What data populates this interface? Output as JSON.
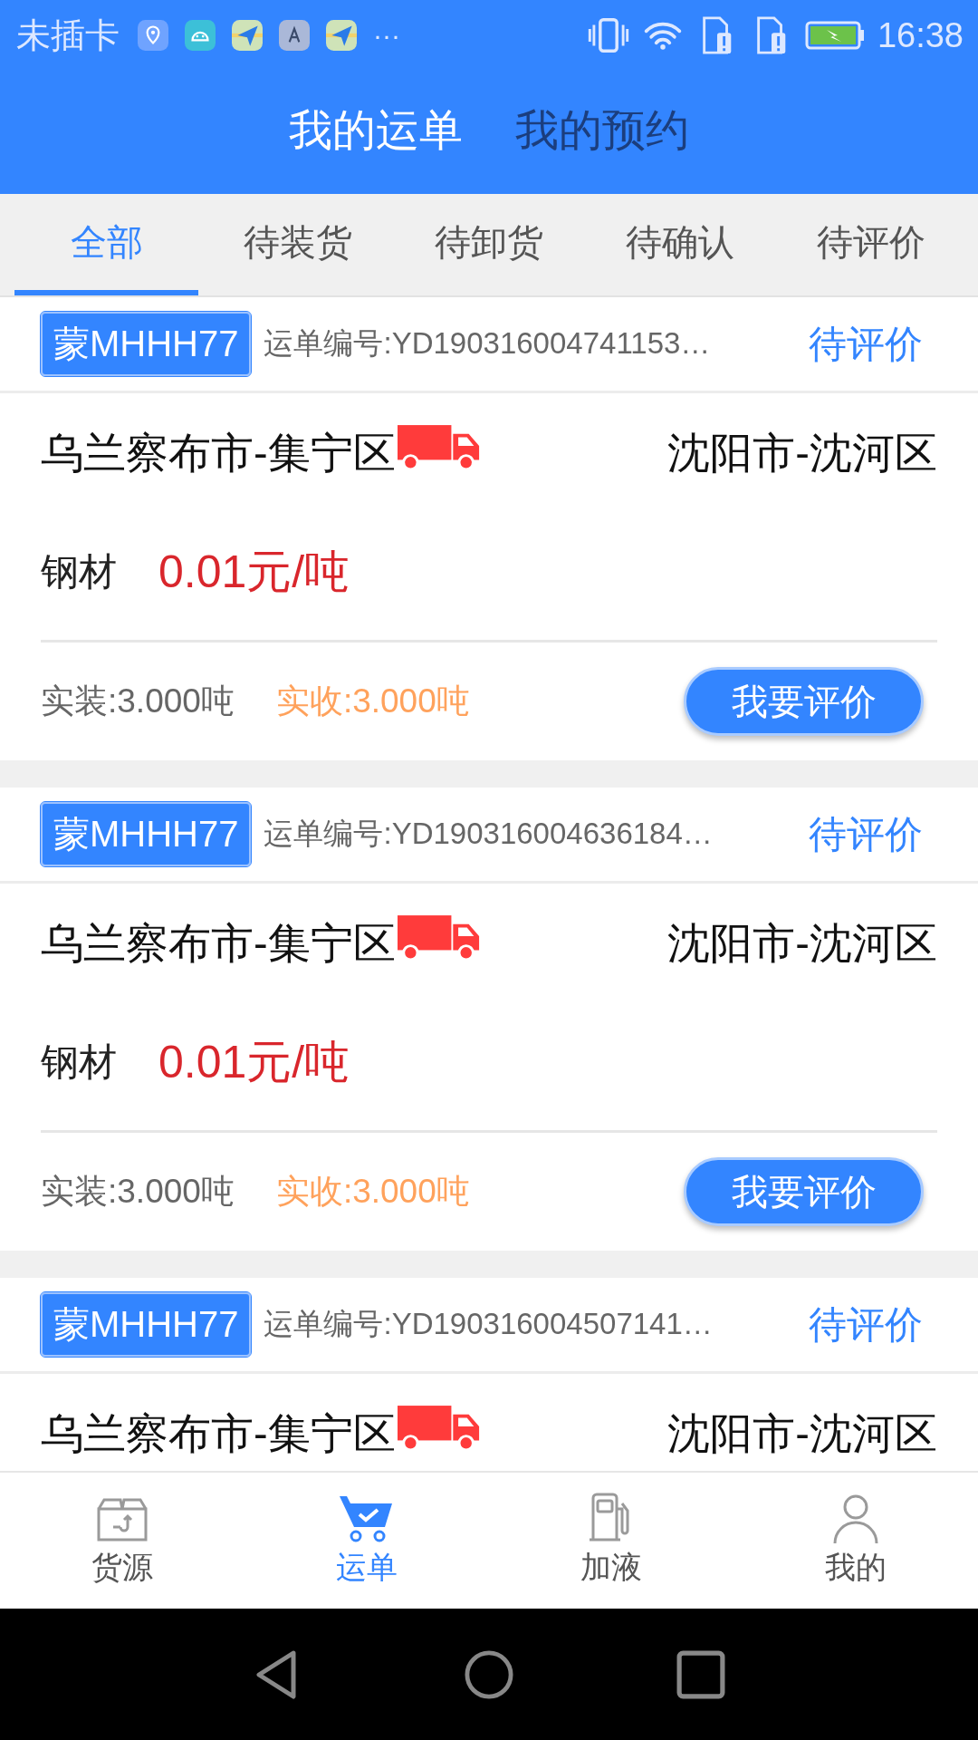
{
  "status_bar": {
    "carrier": "未插卡",
    "more": "···",
    "time": "16:38"
  },
  "header": {
    "tabs": [
      {
        "label": "我的运单",
        "selected": true
      },
      {
        "label": "我的预约",
        "selected": false
      }
    ]
  },
  "filter_tabs": [
    {
      "label": "全部",
      "selected": true
    },
    {
      "label": "待装货",
      "selected": false
    },
    {
      "label": "待卸货",
      "selected": false
    },
    {
      "label": "待确认",
      "selected": false
    },
    {
      "label": "待评价",
      "selected": false
    }
  ],
  "orders": [
    {
      "plate": "蒙MHHH77",
      "order_no": "运单编号:YD190316004741153…",
      "status": "待评价",
      "from": "乌兰察布市-集宁区",
      "to": "沈阳市-沈河区",
      "goods": "钢材",
      "price": "0.01元/吨",
      "loaded": "实装:3.000吨",
      "received": "实收:3.000吨",
      "action": "我要评价"
    },
    {
      "plate": "蒙MHHH77",
      "order_no": "运单编号:YD190316004636184…",
      "status": "待评价",
      "from": "乌兰察布市-集宁区",
      "to": "沈阳市-沈河区",
      "goods": "钢材",
      "price": "0.01元/吨",
      "loaded": "实装:3.000吨",
      "received": "实收:3.000吨",
      "action": "我要评价"
    },
    {
      "plate": "蒙MHHH77",
      "order_no": "运单编号:YD190316004507141…",
      "status": "待评价",
      "from": "乌兰察布市-集宁区",
      "to": "沈阳市-沈河区"
    }
  ],
  "bottom_nav": [
    {
      "label": "货源",
      "selected": false,
      "kind": "box"
    },
    {
      "label": "运单",
      "selected": true,
      "kind": "cart"
    },
    {
      "label": "加液",
      "selected": false,
      "kind": "fuel"
    },
    {
      "label": "我的",
      "selected": false,
      "kind": "person"
    }
  ]
}
